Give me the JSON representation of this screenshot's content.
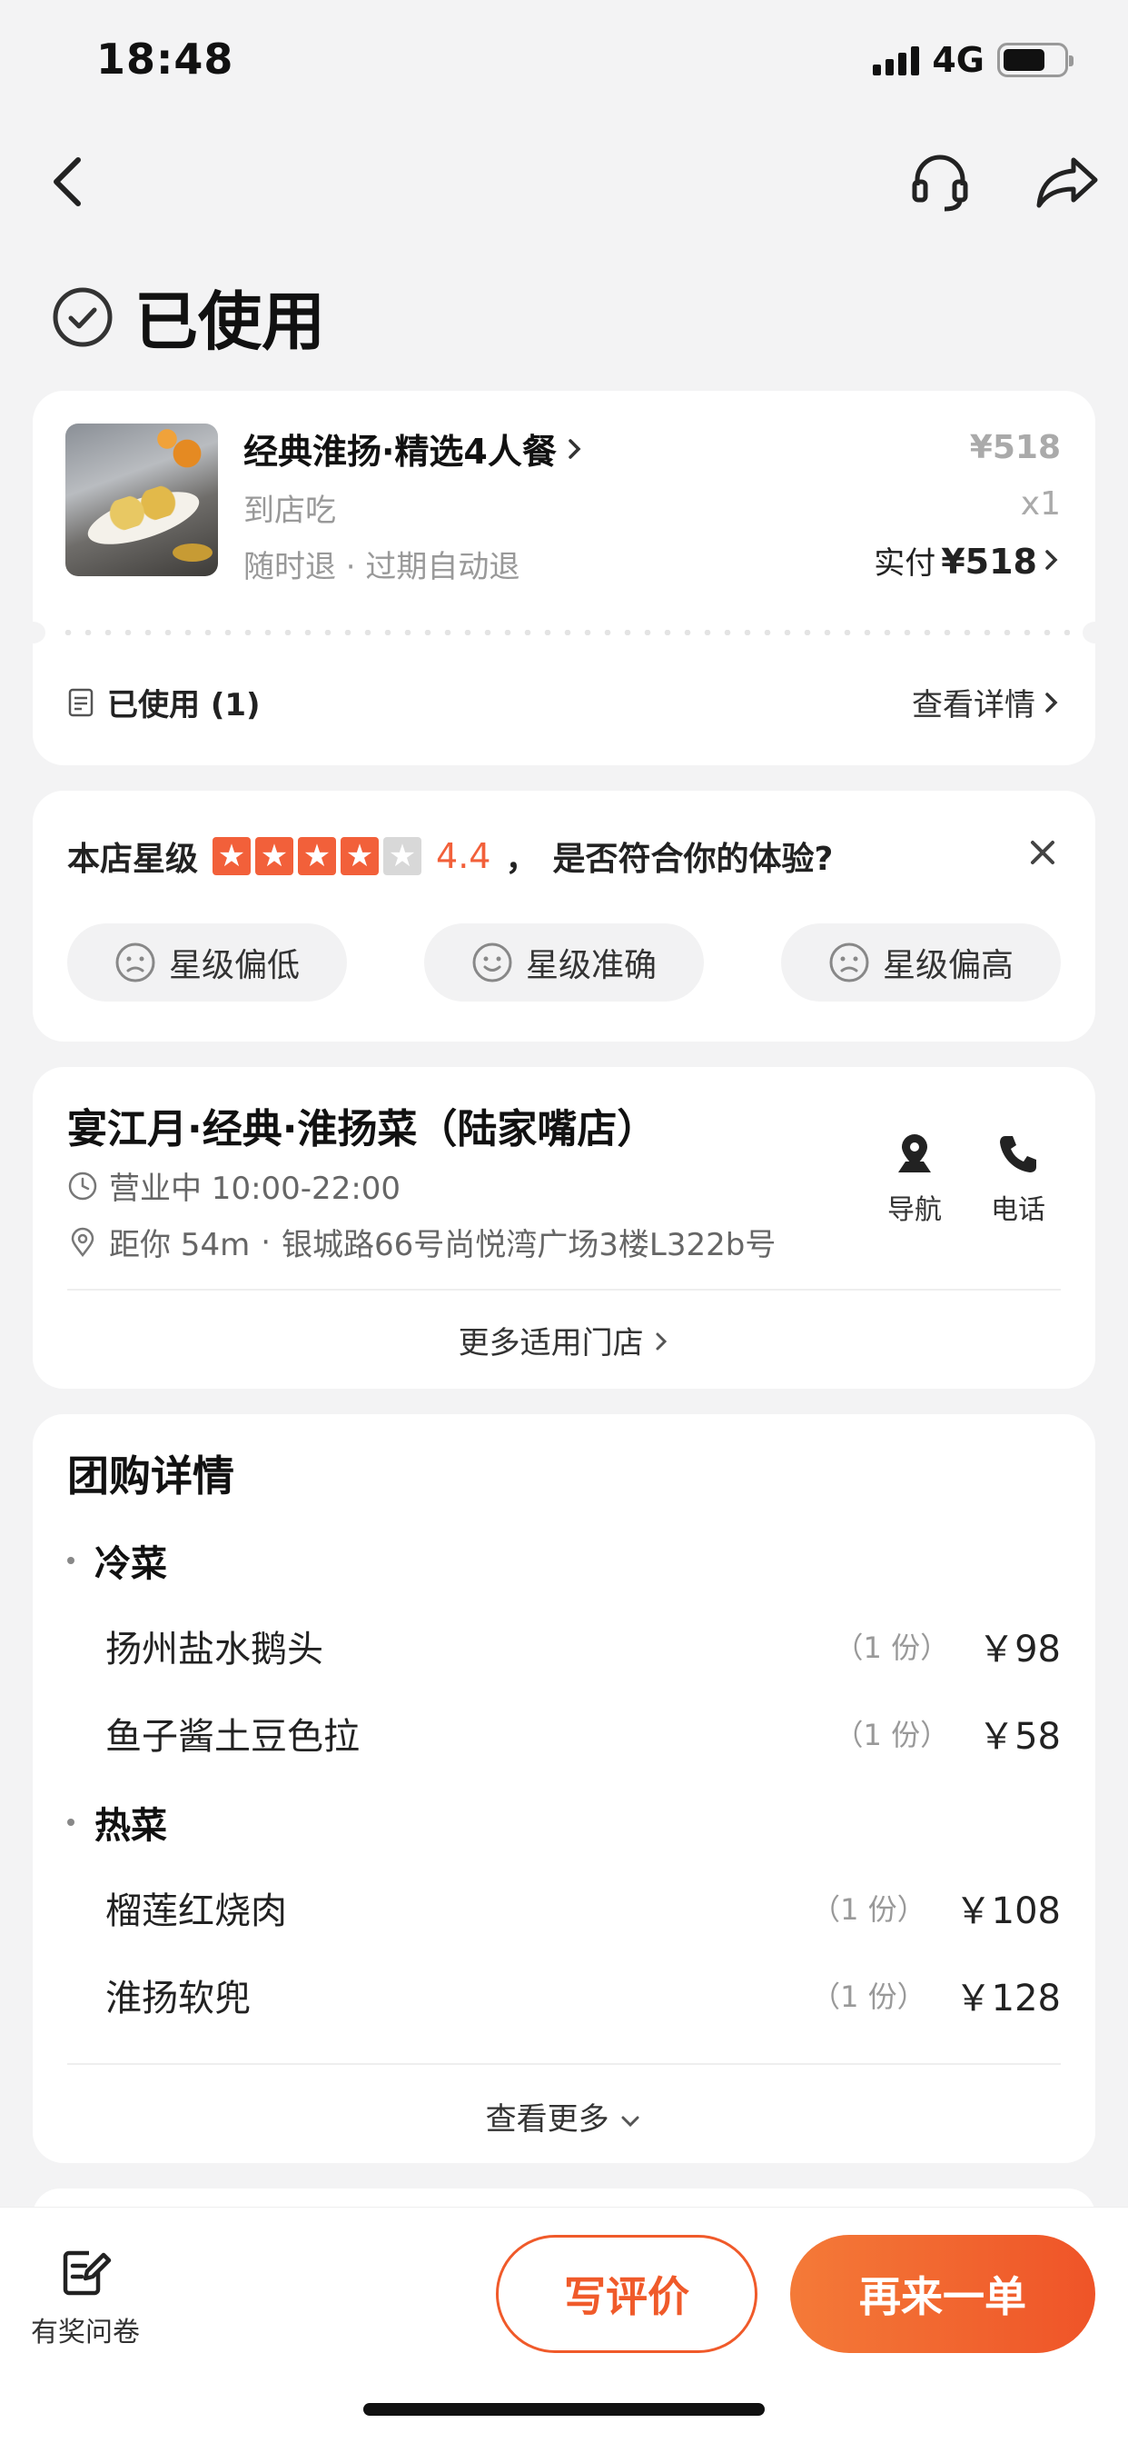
{
  "status_bar": {
    "time": "18:48",
    "network": "4G"
  },
  "page": {
    "title": "已使用"
  },
  "order": {
    "deal_name": "经典淮扬·精选4人餐",
    "consume_type": "到店吃",
    "refund_policy": "随时退 · 过期自动退",
    "price": "¥518",
    "quantity": "x1",
    "paid_label": "实付",
    "paid_amount": "¥518",
    "used_label": "已使用 (1)",
    "detail_link": "查看详情"
  },
  "rating": {
    "label": "本店星级",
    "value": "4.4",
    "stars_filled": 4,
    "stars_total": 5,
    "question": "是否符合你的体验?",
    "separator": "，",
    "options": [
      "星级偏低",
      "星级准确",
      "星级偏高"
    ]
  },
  "shop": {
    "name": "宴江月·经典·淮扬菜（陆家嘴店）",
    "hours": "营业中 10:00-22:00",
    "distance": "距你 54m",
    "address": "银城路66号尚悦湾广场3楼L322b号",
    "nav_label": "导航",
    "call_label": "电话",
    "more_shops": "更多适用门店"
  },
  "group_buy": {
    "title": "团购详情",
    "categories": [
      {
        "name": "冷菜",
        "items": [
          {
            "name": "扬州盐水鹅头",
            "qty": "（1 份）",
            "price": "￥98"
          },
          {
            "name": "鱼子酱土豆色拉",
            "qty": "（1 份）",
            "price": "￥58"
          }
        ]
      },
      {
        "name": "热菜",
        "items": [
          {
            "name": "榴莲红烧肉",
            "qty": "（1 份）",
            "price": "￥108"
          },
          {
            "name": "淮扬软兜",
            "qty": "（1 份）",
            "price": "￥128"
          }
        ]
      }
    ],
    "see_more": "查看更多"
  },
  "bottom_bar": {
    "survey_label": "有奖问卷",
    "review_button": "写评价",
    "reorder_button": "再来一单"
  },
  "colors": {
    "accent": "#f05a2a",
    "star": "#f2603a"
  }
}
